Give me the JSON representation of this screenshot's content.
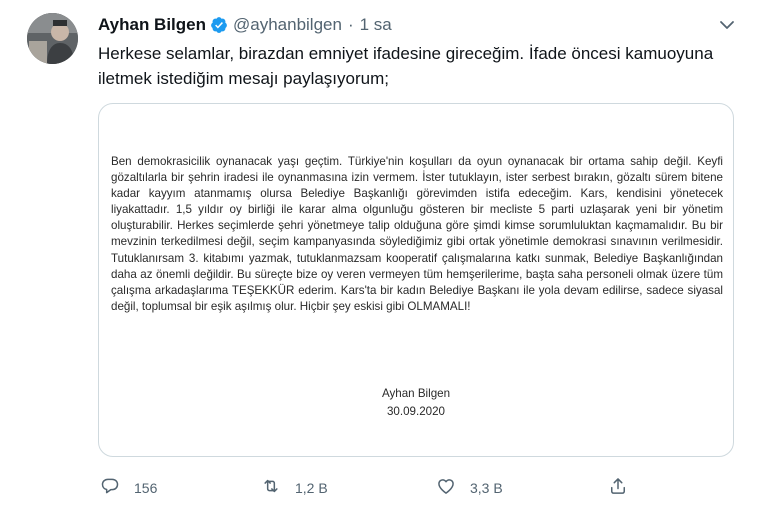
{
  "tweet": {
    "author_name": "Ayhan Bilgen",
    "handle": "@ayhanbilgen",
    "separator": "·",
    "time": "1 sa",
    "text": "Herkese selamlar, birazdan emniyet ifadesine gireceğim. İfade öncesi kamuoyuna iletmek istediğim mesajı paylaşıyorum;",
    "verified": true
  },
  "attachment": {
    "body": "Ben demokrasicilik oynanacak yaşı geçtim. Türkiye'nin koşulları da oyun oynanacak bir ortama sahip değil. Keyfi gözaltılarla bir şehrin iradesi ile oynanmasına izin vermem. İster tutuklayın, ister serbest bırakın, gözaltı sürem bitene kadar kayyım atanmamış olursa Belediye Başkanlığı görevimden istifa edeceğim. Kars, kendisini yönetecek liyakattadır. 1,5 yıldır oy birliği ile karar alma olgunluğu gösteren bir mecliste 5 parti uzlaşarak yeni bir yönetim oluşturabilir. Herkes seçimlerde şehri yönetmeye talip olduğuna göre şimdi kimse sorumluluktan kaçmamalıdır. Bu bir mevzinin terkedilmesi değil, seçim kampanyasında söylediğimiz gibi ortak yönetimle demokrasi sınavının verilmesidir. Tutuklanırsam 3. kitabımı yazmak, tutuklanmazsam kooperatif çalışmalarına katkı sunmak, Belediye Başkanlığından daha az önemli değildir. Bu süreçte bize oy veren vermeyen tüm hemşerilerime, başta saha personeli olmak üzere tüm çalışma arkadaşlarıma TEŞEKKÜR ederim. Kars'ta bir kadın Belediye Başkanı ile yola devam edilirse, sadece siyasal değil, toplumsal bir eşik aşılmış olur. Hiçbir şey eskisi gibi OLMAMALI!",
    "signature_name": "Ayhan Bilgen",
    "signature_date": "30.09.2020"
  },
  "actions": {
    "reply_count": "156",
    "retweet_count": "1,2 B",
    "like_count": "3,3 B"
  },
  "icons": {
    "verified": "verified-badge-icon",
    "chevron": "chevron-down-icon",
    "reply": "reply-icon",
    "retweet": "retweet-icon",
    "like": "heart-icon",
    "share": "share-icon"
  },
  "colors": {
    "text": "#0f1419",
    "secondary": "#536471",
    "verified": "#1d9bf0",
    "border": "#cfd9de"
  }
}
